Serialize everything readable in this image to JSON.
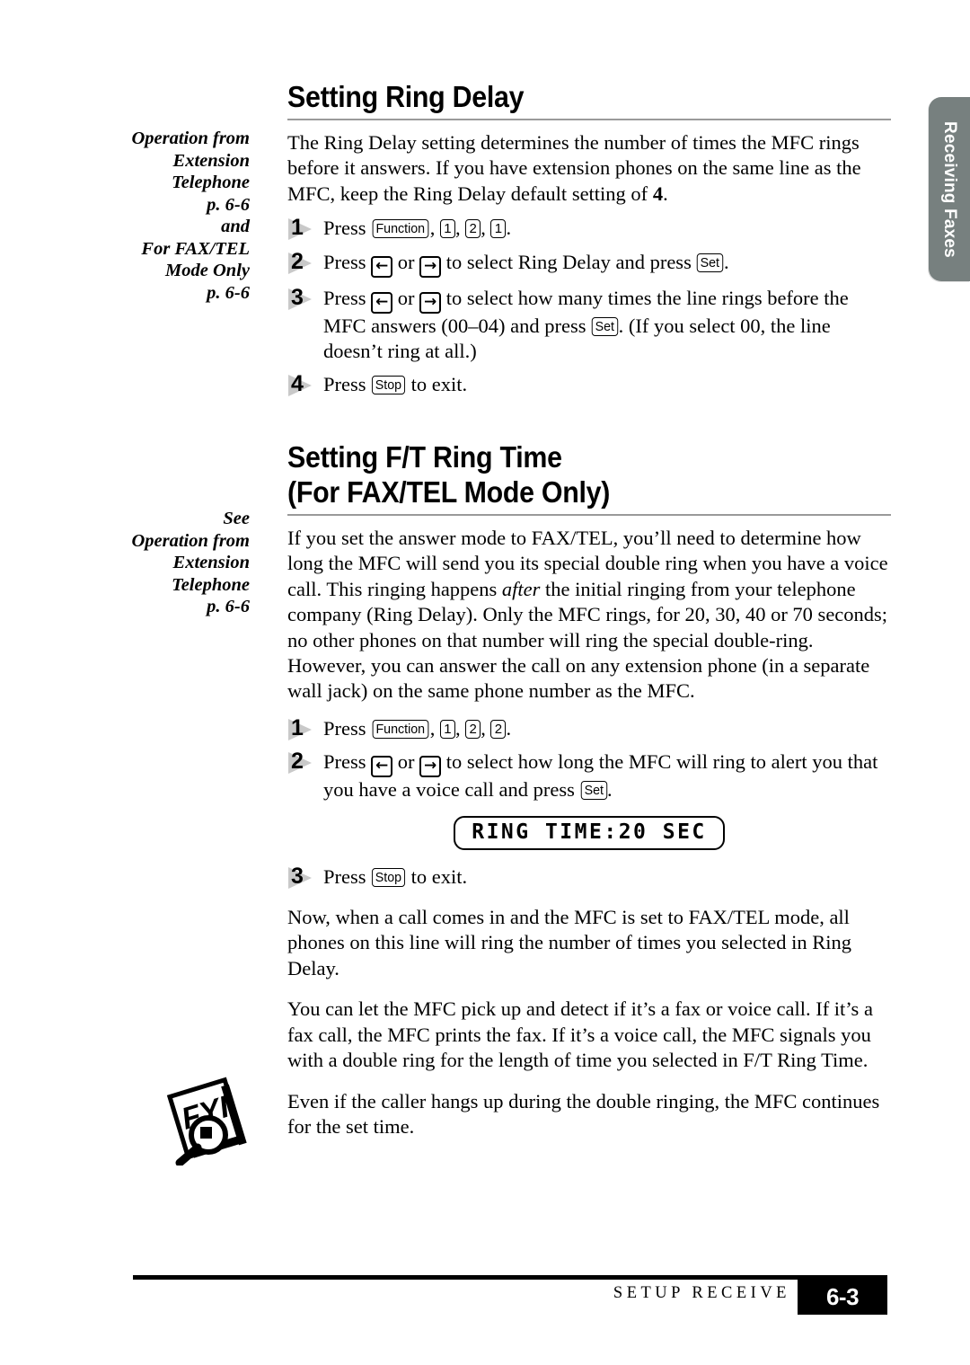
{
  "side_tab": {
    "label": "Receiving Faxes",
    "color": "#77807f"
  },
  "sections": [
    {
      "title": "Setting Ring Delay",
      "margin_note": "Operation from\nExtension\nTelephone\np. 6-6\nand\nFor FAX/TEL\nMode Only\np. 6-6",
      "intro": {
        "part1": "The Ring Delay setting determines the number of times the MFC rings before it answers.  If you have extension phones on the same line as the MFC, keep the Ring Delay default setting of ",
        "bold_value": "4",
        "part2": "."
      },
      "steps": [
        {
          "num": "1",
          "press_label": "Press ",
          "keys": [
            "Function",
            "1",
            "2",
            "1"
          ],
          "trailing": "."
        },
        {
          "num": "2",
          "segments": [
            "Press ",
            " or ",
            " to select Ring Delay and press ",
            "."
          ],
          "keys": [
            "left-arrow",
            "right-arrow",
            "Set"
          ]
        },
        {
          "num": "3",
          "segments": [
            "Press ",
            " or ",
            " to select how many times the line rings before the MFC answers (00–04) and press ",
            ". (If you select 00, the line doesn’t ring at all.)"
          ],
          "keys": [
            "left-arrow",
            "right-arrow",
            "Set"
          ]
        },
        {
          "num": "4",
          "segments": [
            "Press ",
            " to exit."
          ],
          "keys": [
            "Stop"
          ]
        }
      ]
    },
    {
      "title_line1": "Setting F/T Ring Time",
      "title_line2": "(For FAX/TEL Mode Only)",
      "margin_note": "See\nOperation from\nExtension\nTelephone\np. 6-6",
      "intro": {
        "part1": "If you set the answer mode to FAX/TEL, you’ll need to determine how long the MFC will send you its special double ring when you have a voice call.  This ringing happens ",
        "italic_value": "after",
        "part2": " the initial ringing from your telephone company (Ring Delay).  Only the MFC rings, for 20, 30, 40 or 70 seconds; no other phones on that number will ring the special double-ring. However, you can answer the call on any extension phone (in a separate wall jack) on the same phone number as the MFC."
      },
      "steps": [
        {
          "num": "1",
          "press_label": "Press ",
          "keys": [
            "Function",
            "1",
            "2",
            "2"
          ],
          "trailing": "."
        },
        {
          "num": "2",
          "segments": [
            "Press ",
            " or ",
            " to select how long the MFC will ring to alert you that you have a voice call and press ",
            "."
          ],
          "keys": [
            "left-arrow",
            "right-arrow",
            "Set"
          ]
        },
        {
          "num": "3",
          "segments": [
            "Press ",
            " to exit."
          ],
          "keys": [
            "Stop"
          ]
        }
      ],
      "lcd": "RING TIME:20 SEC",
      "paragraphs": [
        "Now, when a call comes in and the MFC is set to FAX/TEL mode, all phones on this line will ring the number of times you selected in Ring Delay.",
        "You can let the MFC pick up and detect if it’s a fax or voice call. If it’s a fax call, the MFC prints the fax. If it’s a voice call, the MFC signals you with a double ring for the length of time you selected in F/T Ring Time.",
        "Even if the caller hangs up during the double ringing, the MFC continues for the set time."
      ]
    }
  ],
  "keys": {
    "function": "Function",
    "set": "Set",
    "stop": "Stop",
    "one": "1",
    "two": "2",
    "left_arrow": "←",
    "right_arrow": "→"
  },
  "fyi_icon": {
    "text": "FYI"
  },
  "footer": {
    "label": "SETUP RECEIVE",
    "page": "6-3"
  }
}
